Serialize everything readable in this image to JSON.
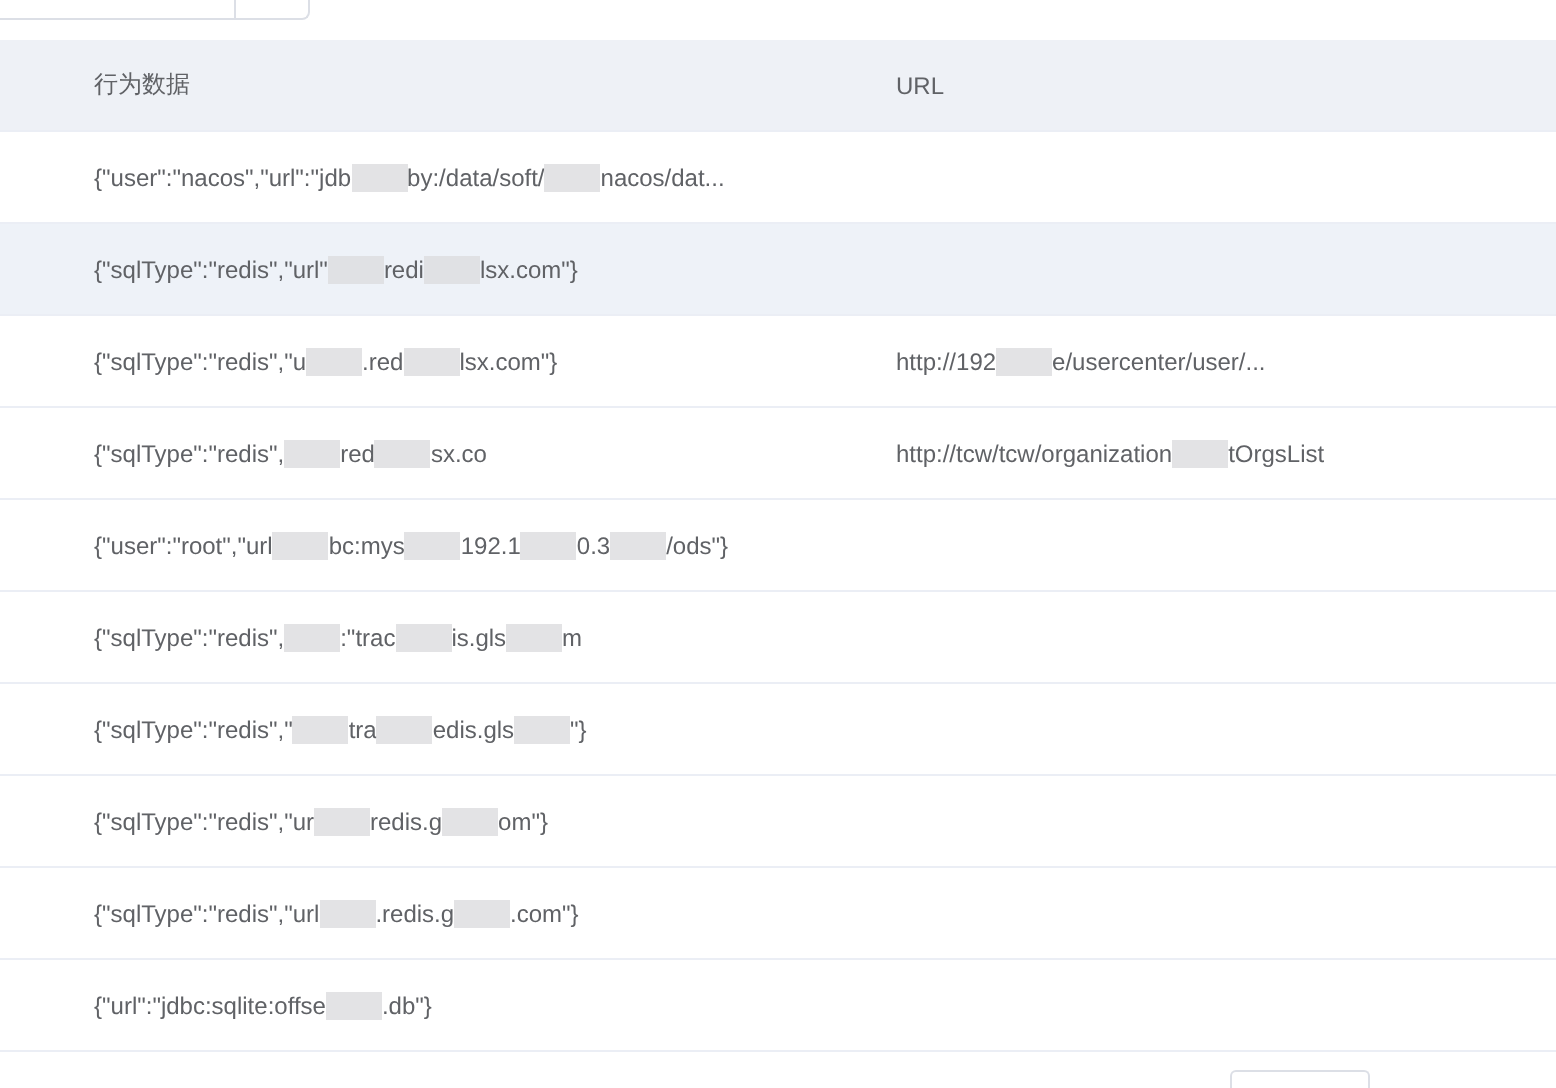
{
  "table": {
    "columns": [
      "行为数据",
      "URL"
    ],
    "rows": [
      {
        "highlighted": false,
        "data": [
          "{\"user\":\"nacos\",\"url\":\"jdb",
          "by:/data/soft/",
          "nacos/dat..."
        ],
        "url": []
      },
      {
        "highlighted": true,
        "data": [
          "{\"sqlType\":\"redis\",\"url\"",
          "redi",
          "lsx.com\"}"
        ],
        "url": []
      },
      {
        "highlighted": false,
        "data": [
          "{\"sqlType\":\"redis\",\"u",
          ".red",
          "lsx.com\"}"
        ],
        "url": [
          "http://192",
          "e/usercenter/user/..."
        ]
      },
      {
        "highlighted": false,
        "data": [
          "{\"sqlType\":\"redis\",",
          "red",
          "sx.co"
        ],
        "url": [
          "http://tcw/tcw/organization",
          "tOrgsList"
        ]
      },
      {
        "highlighted": false,
        "data": [
          "{\"user\":\"root\",\"url",
          "bc:mys",
          "192.1",
          "0.3",
          "/ods\"}"
        ],
        "url": []
      },
      {
        "highlighted": false,
        "data": [
          "{\"sqlType\":\"redis\",",
          ":\"trac",
          "is.gls",
          "m"
        ],
        "url": []
      },
      {
        "highlighted": false,
        "data": [
          "{\"sqlType\":\"redis\",\"",
          "tra",
          "edis.gls",
          "\"}"
        ],
        "url": []
      },
      {
        "highlighted": false,
        "data": [
          "{\"sqlType\":\"redis\",\"ur",
          "redis.g",
          "om\"}"
        ],
        "url": []
      },
      {
        "highlighted": false,
        "data": [
          "{\"sqlType\":\"redis\",\"url",
          ".redis.g",
          ".com\"}"
        ],
        "url": []
      },
      {
        "highlighted": false,
        "data": [
          "{\"url\":\"jdbc:sqlite:offse",
          ".db\"}"
        ],
        "url": []
      }
    ]
  }
}
